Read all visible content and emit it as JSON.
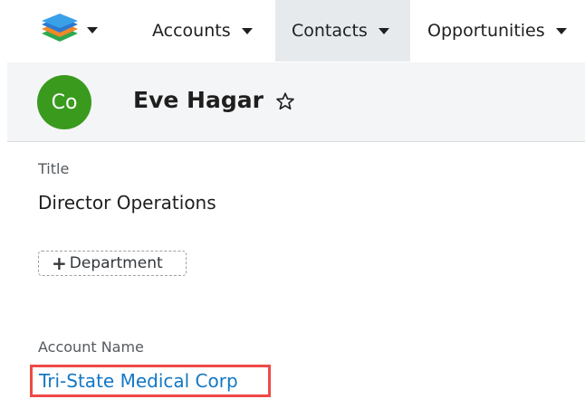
{
  "nav": {
    "logo_icon": "stacked-layers-logo",
    "tabs": [
      {
        "label": "Accounts",
        "active": false
      },
      {
        "label": "Contacts",
        "active": true
      },
      {
        "label": "Opportunities",
        "active": false
      }
    ]
  },
  "record": {
    "avatar_initials": "Co",
    "avatar_color": "#3a9a1e",
    "name": "Eve Hagar",
    "favorite_icon": "star-outline-icon"
  },
  "fields": {
    "title_label": "Title",
    "title_value": "Director Operations",
    "department_button": "Department",
    "account_label": "Account Name",
    "account_value": "Tri-State Medical Corp"
  },
  "colors": {
    "link": "#1378c5",
    "highlight_border": "#ef4a47",
    "active_tab_bg": "#e6eaed"
  }
}
